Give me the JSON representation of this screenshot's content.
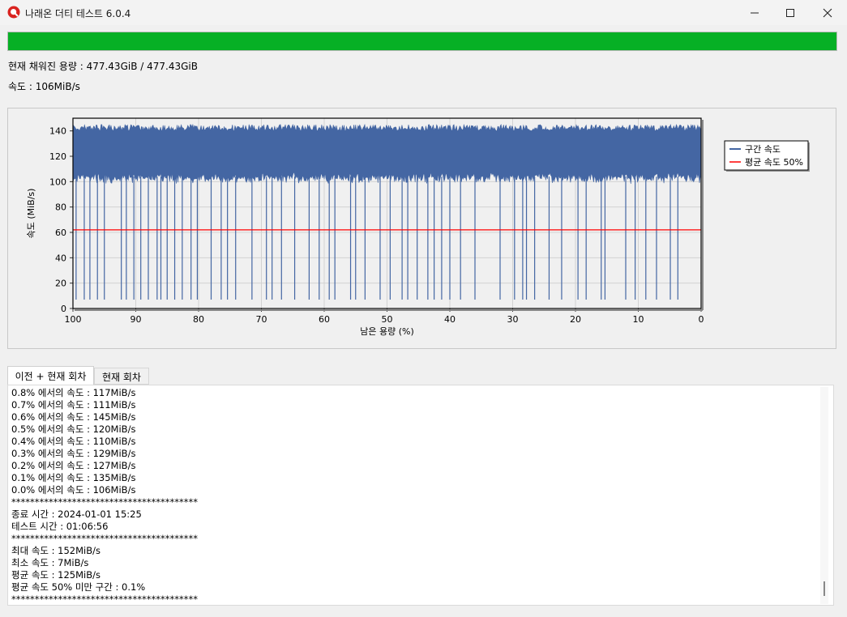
{
  "window": {
    "title": "나래온 더티 테스트 6.0.4",
    "accent": "#06b025",
    "chart_line_color": "#4466a3",
    "avg_line_color": "#ff0000"
  },
  "progress": {
    "percent": 100
  },
  "info": {
    "filled": "현재 채워진 용량 : 477.43GiB / 477.43GiB",
    "speed": "속도 : 106MiB/s"
  },
  "chart_data": {
    "type": "line",
    "xlabel": "남은 용량 (%)",
    "ylabel": "속도 (MiB/s)",
    "xlim": [
      100,
      0
    ],
    "ylim": [
      0,
      150
    ],
    "x_ticks": [
      "100",
      "90",
      "80",
      "70",
      "60",
      "50",
      "40",
      "30",
      "20",
      "10",
      "0"
    ],
    "y_ticks": [
      "0",
      "20",
      "40",
      "60",
      "80",
      "100",
      "120",
      "140"
    ],
    "grid": true,
    "legend": "right",
    "series": [
      {
        "name": "구간 속도",
        "band": [
          104,
          145
        ],
        "dips_to": 7,
        "dips_at": [
          99.5,
          98.2,
          97.3,
          96.1,
          95.0,
          92.3,
          91.5,
          90.3,
          89.2,
          88.0,
          86.6,
          86.0,
          85.0,
          83.8,
          82.6,
          81.2,
          80.2,
          78.0,
          76.4,
          75.4,
          74.1,
          71.5,
          69.2,
          68.3,
          66.8,
          64.7,
          62.4,
          60.8,
          59.2,
          58.3,
          55.8,
          55.0,
          53.5,
          51.1,
          49.5,
          47.6,
          46.7,
          45.2,
          43.5,
          42.5,
          41.3,
          40.0,
          38.3,
          36.0,
          32.0,
          29.7,
          28.4,
          27.8,
          26.5,
          24.2,
          22.2,
          19.6,
          18.3,
          15.9,
          15.3,
          12.0,
          10.5,
          8.8,
          7.1,
          4.9,
          3.7
        ]
      },
      {
        "name": "평균 속도 50%",
        "values": [
          62,
          62
        ]
      }
    ]
  },
  "tabs": [
    {
      "label": "이전 + 현재 회차",
      "active": true
    },
    {
      "label": "현재 회차",
      "active": false
    }
  ],
  "log": [
    "0.8% 에서의 속도 : 117MiB/s",
    "0.7% 에서의 속도 : 111MiB/s",
    "0.6% 에서의 속도 : 145MiB/s",
    "0.5% 에서의 속도 : 120MiB/s",
    "0.4% 에서의 속도 : 110MiB/s",
    "0.3% 에서의 속도 : 129MiB/s",
    "0.2% 에서의 속도 : 127MiB/s",
    "0.1% 에서의 속도 : 135MiB/s",
    "0.0% 에서의 속도 : 106MiB/s",
    "****************************************",
    "종료 시간 : 2024-01-01 15:25",
    "테스트 시간 : 01:06:56",
    "****************************************",
    "최대 속도 : 152MiB/s",
    "최소 속도 : 7MiB/s",
    "평균 속도 : 125MiB/s",
    "평균 속도 50% 미만 구간 : 0.1%",
    "****************************************"
  ]
}
